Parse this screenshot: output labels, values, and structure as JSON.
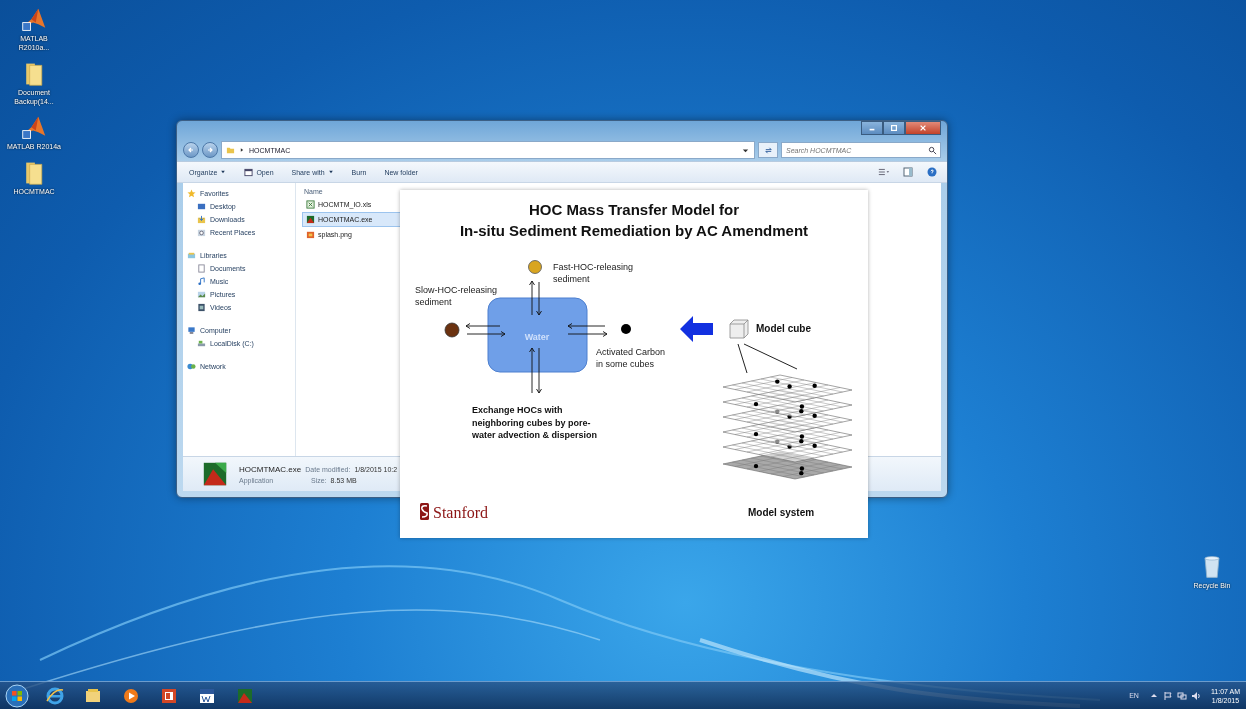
{
  "desktop_icons": [
    {
      "kind": "matlab",
      "label": "MATLAB R2010a..."
    },
    {
      "kind": "folder",
      "label": "Document Backup(14..."
    },
    {
      "kind": "matlab",
      "label": "MATLAB R2014a"
    },
    {
      "kind": "folder",
      "label": "HOCMTMAC"
    }
  ],
  "recycle_bin": {
    "label": "Recycle Bin"
  },
  "explorer": {
    "breadcrumb": "HOCMTMAC",
    "search": {
      "placeholder": "Search HOCMTMAC"
    },
    "toolbar": [
      {
        "label": "Organize",
        "dropdown": true,
        "kind": "text"
      },
      {
        "label": "Open",
        "dropdown": false,
        "kind": "open"
      },
      {
        "label": "Share with",
        "dropdown": true,
        "kind": "text"
      },
      {
        "label": "Burn",
        "dropdown": false,
        "kind": "text"
      },
      {
        "label": "New folder",
        "dropdown": false,
        "kind": "text"
      }
    ],
    "nav": [
      {
        "label": "Favorites",
        "kind": "star",
        "children": [
          {
            "label": "Desktop",
            "kind": "desktop"
          },
          {
            "label": "Downloads",
            "kind": "downloads"
          },
          {
            "label": "Recent Places",
            "kind": "recent"
          }
        ]
      },
      {
        "label": "Libraries",
        "kind": "library",
        "children": [
          {
            "label": "Documents",
            "kind": "documents"
          },
          {
            "label": "Music",
            "kind": "music"
          },
          {
            "label": "Pictures",
            "kind": "pictures"
          },
          {
            "label": "Videos",
            "kind": "videos"
          }
        ]
      },
      {
        "label": "Computer",
        "kind": "computer",
        "children": [
          {
            "label": "LocalDisk (C:)",
            "kind": "disk"
          }
        ]
      },
      {
        "label": "Network",
        "kind": "network"
      }
    ],
    "column": "Name",
    "files": [
      {
        "name": "HOCMTM_IO.xls",
        "kind": "xls",
        "selected": false
      },
      {
        "name": "HOCMTMAC.exe",
        "kind": "exe",
        "selected": true
      },
      {
        "name": "splash.png",
        "kind": "png",
        "selected": false
      }
    ],
    "details": {
      "name": "HOCMTMAC.exe",
      "type": "Application",
      "date_label": "Date modified:",
      "date": "1/8/2015 10:2",
      "size_label": "Size:",
      "size": "8.53 MB"
    }
  },
  "splash": {
    "title": [
      "HOC Mass Transfer Model for",
      "In-situ Sediment Remediation by AC Amendment"
    ],
    "fast_label": [
      "Fast-HOC-releasing",
      "sediment"
    ],
    "slow_label": [
      "Slow-HOC-releasing",
      "sediment"
    ],
    "water_label": "Water",
    "carbon_label": [
      "Activated Carbon",
      "in some cubes"
    ],
    "exchange_label": [
      "Exchange HOCs with",
      "neighboring cubes by pore-",
      "water advection & dispersion"
    ],
    "cube_label": "Model cube",
    "system_label": "Model system",
    "logo": "Stanford"
  },
  "taskbar": {
    "apps": [
      {
        "kind": "ie"
      },
      {
        "kind": "explorer"
      },
      {
        "kind": "media"
      },
      {
        "kind": "powerpoint"
      },
      {
        "kind": "word"
      },
      {
        "kind": "matlab"
      }
    ],
    "language": "EN",
    "time": "11:07 AM",
    "date": "1/8/2015"
  }
}
